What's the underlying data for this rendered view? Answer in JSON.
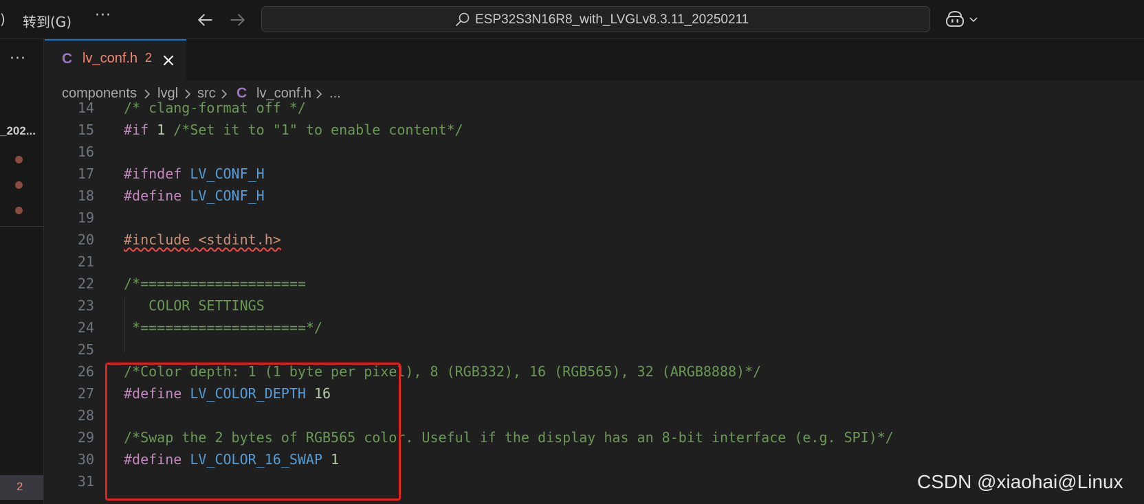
{
  "titlebar": {
    "menu_paren": ")",
    "menu_goto": "转到(G)",
    "menu_more": "···",
    "command_center_title": "ESP32S3N16R8_with_LVGLv8.3.11_20250211"
  },
  "sidebar": {
    "more": "···",
    "folder_label": "_202...",
    "problem_count": "2"
  },
  "tab": {
    "icon_letter": "C",
    "label": "lv_conf.h",
    "badge": "2"
  },
  "breadcrumb": {
    "items": [
      "components",
      "lvgl",
      "src",
      "lv_conf.h",
      "..."
    ],
    "file_icon_letter": "C"
  },
  "editor": {
    "lines": [
      {
        "n": "14",
        "t": [
          {
            "c": "tok-comment",
            "s": "/* clang-format off */"
          }
        ]
      },
      {
        "n": "15",
        "t": [
          {
            "c": "tok-keyword",
            "s": "#if"
          },
          {
            "c": "",
            "s": " "
          },
          {
            "c": "tok-number",
            "s": "1"
          },
          {
            "c": "",
            "s": " "
          },
          {
            "c": "tok-comment",
            "s": "/*Set it to \"1\" to enable content*/"
          }
        ]
      },
      {
        "n": "16",
        "t": []
      },
      {
        "n": "17",
        "t": [
          {
            "c": "tok-keyword",
            "s": "#ifndef"
          },
          {
            "c": "",
            "s": " "
          },
          {
            "c": "tok-macro",
            "s": "LV_CONF_H"
          }
        ]
      },
      {
        "n": "18",
        "t": [
          {
            "c": "tok-keyword",
            "s": "#define"
          },
          {
            "c": "",
            "s": " "
          },
          {
            "c": "tok-macro",
            "s": "LV_CONF_H"
          }
        ]
      },
      {
        "n": "19",
        "t": []
      },
      {
        "n": "20",
        "t": [
          {
            "c": "tok-keyword tok-include",
            "s": "#include"
          },
          {
            "c": "tok-include",
            "s": " <stdint.h>"
          }
        ]
      },
      {
        "n": "21",
        "t": []
      },
      {
        "n": "22",
        "t": [
          {
            "c": "tok-comment",
            "s": "/*===================="
          }
        ]
      },
      {
        "n": "23",
        "t": [
          {
            "c": "tok-comment",
            "s": "   COLOR SETTINGS"
          }
        ]
      },
      {
        "n": "24",
        "t": [
          {
            "c": "tok-comment",
            "s": " *====================*/"
          }
        ]
      },
      {
        "n": "25",
        "t": []
      },
      {
        "n": "26",
        "t": [
          {
            "c": "tok-comment",
            "s": "/*Color depth: 1 (1 byte per pixel), 8 (RGB332), 16 (RGB565), 32 (ARGB8888)*/"
          }
        ]
      },
      {
        "n": "27",
        "t": [
          {
            "c": "tok-keyword",
            "s": "#define"
          },
          {
            "c": "",
            "s": " "
          },
          {
            "c": "tok-macro",
            "s": "LV_COLOR_DEPTH"
          },
          {
            "c": "",
            "s": " "
          },
          {
            "c": "tok-number",
            "s": "16"
          }
        ]
      },
      {
        "n": "28",
        "t": []
      },
      {
        "n": "29",
        "t": [
          {
            "c": "tok-comment",
            "s": "/*Swap the 2 bytes of RGB565 color. Useful if the display has an 8-bit interface (e.g. SPI)*/"
          }
        ]
      },
      {
        "n": "30",
        "t": [
          {
            "c": "tok-keyword",
            "s": "#define"
          },
          {
            "c": "",
            "s": " "
          },
          {
            "c": "tok-macro",
            "s": "LV_COLOR_16_SWAP"
          },
          {
            "c": "",
            "s": " "
          },
          {
            "c": "tok-number",
            "s": "1"
          }
        ]
      },
      {
        "n": "31",
        "t": []
      }
    ]
  },
  "watermark": "CSDN @xiaohai@Linux",
  "colors": {
    "accent": "#0078d4",
    "error": "#f48771",
    "highlight": "#e0231d"
  },
  "icons": [
    "arrow-left-icon",
    "arrow-right-icon",
    "search-icon",
    "copilot-icon",
    "chevron-down-icon",
    "close-icon",
    "chevron-right-icon"
  ]
}
